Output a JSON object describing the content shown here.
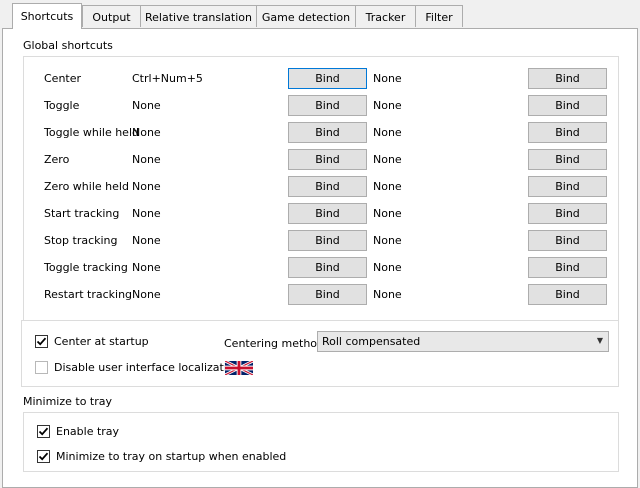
{
  "tabs": [
    {
      "label": "Shortcuts",
      "active": true
    },
    {
      "label": "Output"
    },
    {
      "label": "Relative translation"
    },
    {
      "label": "Game detection"
    },
    {
      "label": "Tracker"
    },
    {
      "label": "Filter"
    }
  ],
  "global_shortcuts": {
    "title": "Global shortcuts",
    "button_label": "Bind",
    "rows": [
      {
        "name": "Center",
        "key1": "Ctrl+Num+5",
        "key2": "None"
      },
      {
        "name": "Toggle",
        "key1": "None",
        "key2": "None"
      },
      {
        "name": "Toggle while held",
        "key1": "None",
        "key2": "None"
      },
      {
        "name": "Zero",
        "key1": "None",
        "key2": "None"
      },
      {
        "name": "Zero while held",
        "key1": "None",
        "key2": "None"
      },
      {
        "name": "Start tracking",
        "key1": "None",
        "key2": "None"
      },
      {
        "name": "Stop tracking",
        "key1": "None",
        "key2": "None"
      },
      {
        "name": "Toggle tracking",
        "key1": "None",
        "key2": "None"
      },
      {
        "name": "Restart tracking",
        "key1": "None",
        "key2": "None"
      }
    ]
  },
  "options": {
    "center_at_startup": {
      "label": "Center at startup",
      "checked": true
    },
    "disable_localization": {
      "label": "Disable user interface localization",
      "checked": false
    },
    "centering_method": {
      "label": "Centering method",
      "value": "Roll compensated"
    },
    "flag_icon": "uk-flag-icon"
  },
  "tray": {
    "title": "Minimize to tray",
    "enable_tray": {
      "label": "Enable tray",
      "checked": true
    },
    "minimize_on_startup": {
      "label": "Minimize to tray on startup when enabled",
      "checked": true
    }
  },
  "colors": {
    "focus": "#0078d7",
    "button": "#e1e1e1",
    "border": "#adadad"
  }
}
